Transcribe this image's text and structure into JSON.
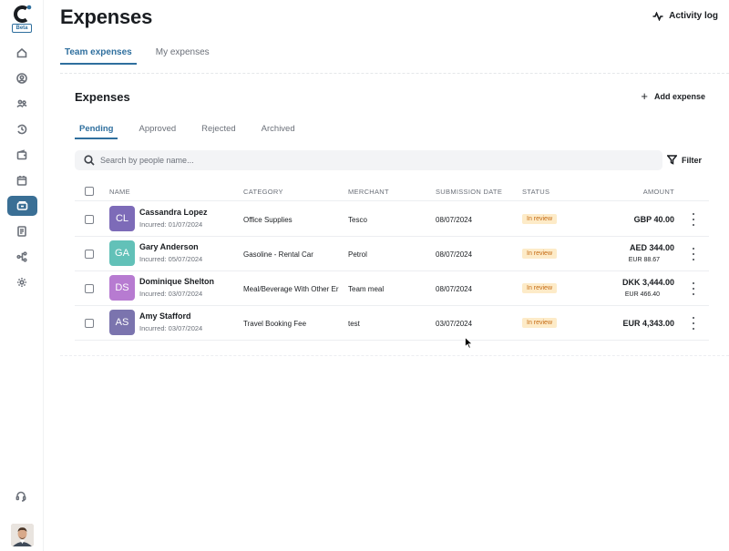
{
  "app": {
    "beta_label": "Beta"
  },
  "header": {
    "title": "Expenses",
    "activity_log": "Activity log"
  },
  "top_tabs": [
    {
      "label": "Team expenses",
      "active": true
    },
    {
      "label": "My expenses",
      "active": false
    }
  ],
  "card": {
    "title": "Expenses",
    "add_label": "Add expense",
    "tabs": [
      {
        "label": "Pending",
        "active": true
      },
      {
        "label": "Approved",
        "active": false
      },
      {
        "label": "Rejected",
        "active": false
      },
      {
        "label": "Archived",
        "active": false
      }
    ],
    "search_placeholder": "Search by people name...",
    "filter_label": "Filter"
  },
  "table": {
    "columns": [
      "NAME",
      "CATEGORY",
      "MERCHANT",
      "SUBMISSION DATE",
      "STATUS",
      "AMOUNT"
    ],
    "rows": [
      {
        "initials": "CL",
        "avatar_color": "#7d6bb8",
        "name": "Cassandra Lopez",
        "incurred": "Incurred: 01/07/2024",
        "category": "Office Supplies",
        "merchant": "Tesco",
        "date": "08/07/2024",
        "status": "In review",
        "amount": "GBP 40.00",
        "amount_sub": ""
      },
      {
        "initials": "GA",
        "avatar_color": "#62c1b8",
        "name": "Gary Anderson",
        "incurred": "Incurred: 05/07/2024",
        "category": "Gasoline - Rental Car",
        "merchant": "Petrol",
        "date": "08/07/2024",
        "status": "In review",
        "amount": "AED 344.00",
        "amount_sub": "EUR 88.67"
      },
      {
        "initials": "DS",
        "avatar_color": "#b77bd1",
        "name": "Dominique Shelton",
        "incurred": "Incurred: 03/07/2024",
        "category": "Meal/Beverage With Other Er",
        "merchant": "Team meal",
        "date": "08/07/2024",
        "status": "In review",
        "amount": "DKK 3,444.00",
        "amount_sub": "EUR 466.40"
      },
      {
        "initials": "AS",
        "avatar_color": "#7b74ae",
        "name": "Amy Stafford",
        "incurred": "Incurred: 03/07/2024",
        "category": "Travel Booking Fee",
        "merchant": "test",
        "date": "03/07/2024",
        "status": "In review",
        "amount": "EUR 4,343.00",
        "amount_sub": ""
      }
    ]
  },
  "colors": {
    "accent": "#2f6f9e",
    "nav_active": "#3a6f95",
    "status_bg": "#fdebc8",
    "status_text": "#c56a12"
  },
  "sidebar_icons": [
    "home-icon",
    "user-circle-icon",
    "team-icon",
    "time-off-icon",
    "wallet-icon",
    "calendar-icon",
    "expenses-icon",
    "document-icon",
    "org-chart-icon",
    "settings-icon",
    "support-icon"
  ]
}
